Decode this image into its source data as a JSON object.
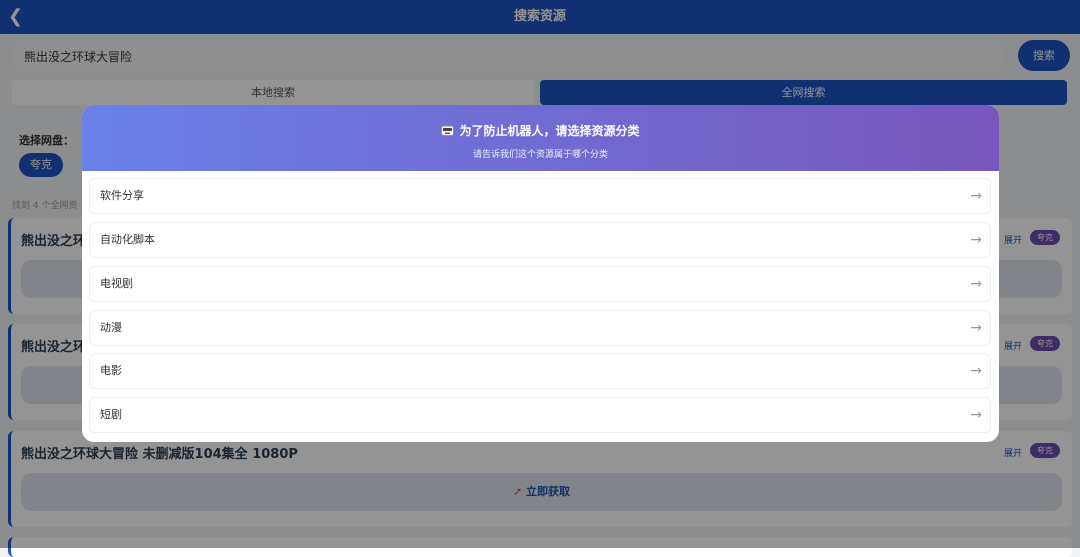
{
  "header": {
    "title": "搜索资源"
  },
  "search": {
    "query": "熊出没之环球大冒险",
    "button_label": "搜索"
  },
  "tabs": {
    "local": "本地搜索",
    "global": "全网搜索"
  },
  "netdisk": {
    "label": "选择网盘：",
    "selected": "夸克"
  },
  "results": {
    "found_text": "找到 4 个全网资",
    "cards": [
      {
        "title": "熊出没之环",
        "expand": "展开",
        "tag": "夸克"
      },
      {
        "title": "熊出没之环",
        "expand": "展开",
        "tag": "夸克"
      },
      {
        "title": "熊出没之环球大冒险 未删减版104集全 1080P",
        "expand": "展开",
        "tag": "夸克",
        "get_label": "立即获取"
      }
    ]
  },
  "modal": {
    "title": "为了防止机器人，请选择资源分类",
    "subtitle": "请告诉我们这个资源属于哪个分类",
    "options": [
      "软件分享",
      "自动化脚本",
      "电视剧",
      "动漫",
      "电影",
      "短剧"
    ],
    "arrow": "→"
  },
  "colors": {
    "primary": "#1e54c4",
    "gradient_start": "#6a80e9",
    "gradient_end": "#7757bd",
    "tag": "#6c4cb0"
  }
}
